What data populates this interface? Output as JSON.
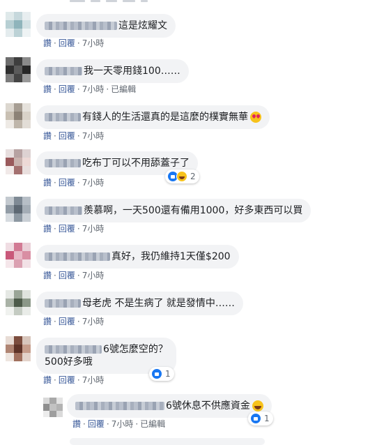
{
  "comments": [
    {
      "text": "這是炫耀文",
      "line2": "",
      "actions": {
        "like": "讚",
        "reply": "回覆",
        "time": "7小時",
        "edited": ""
      },
      "reaction_count": ""
    },
    {
      "text": "我一天零用錢100……",
      "line2": "",
      "actions": {
        "like": "讚",
        "reply": "回覆",
        "time": "7小時",
        "edited": "已編輯"
      },
      "reaction_count": ""
    },
    {
      "text": "有錢人的生活還真的是這麼的樸實無華",
      "line2": "",
      "actions": {
        "like": "讚",
        "reply": "回覆",
        "time": "7小時",
        "edited": ""
      },
      "reaction_count": ""
    },
    {
      "text": "吃布丁可以不用舔蓋子了",
      "line2": "",
      "actions": {
        "like": "讚",
        "reply": "回覆",
        "time": "7小時",
        "edited": ""
      },
      "reaction_count": "2"
    },
    {
      "text": "羨慕啊，一天500還有備用1000，好多東西可以買",
      "line2": "",
      "actions": {
        "like": "讚",
        "reply": "回覆",
        "time": "7小時",
        "edited": ""
      },
      "reaction_count": ""
    },
    {
      "text": "真好，我仍維持1天僅$200",
      "line2": "",
      "actions": {
        "like": "讚",
        "reply": "回覆",
        "time": "7小時",
        "edited": ""
      },
      "reaction_count": ""
    },
    {
      "text": "母老虎 不是生病了 就是發情中……",
      "line2": "",
      "actions": {
        "like": "讚",
        "reply": "回覆",
        "time": "7小時",
        "edited": ""
      },
      "reaction_count": ""
    },
    {
      "text": "6號怎麼空的？",
      "line2": "500好多哦",
      "actions": {
        "like": "讚",
        "reply": "回覆",
        "time": "7小時",
        "edited": ""
      },
      "reaction_count": "1"
    }
  ],
  "reply": {
    "text": "6號休息不供應資金",
    "actions": {
      "like": "讚",
      "reply": "回覆",
      "time": "7小時",
      "edited": "已編輯"
    },
    "reaction_count": "1"
  },
  "colors": {
    "link": "#385898",
    "meta": "#606770",
    "bubble": "#f2f3f5",
    "like_blue": "#1877f2"
  }
}
